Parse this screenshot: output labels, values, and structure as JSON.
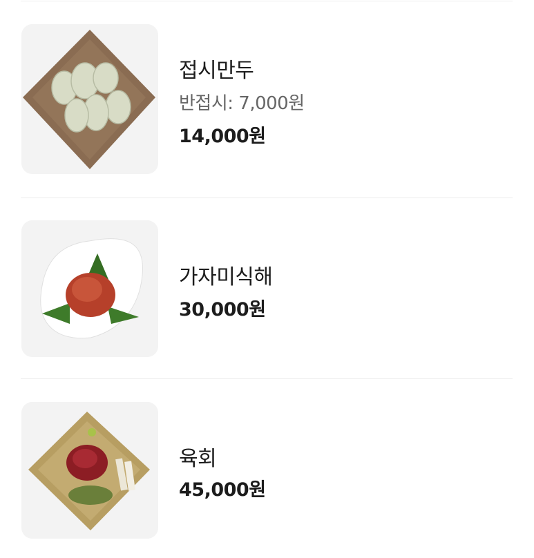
{
  "menu": {
    "items": [
      {
        "name": "접시만두",
        "option": "반접시: 7,000원",
        "price": "14,000원",
        "image": "dumplings-plate-image"
      },
      {
        "name": "가자미식해",
        "price": "30,000원",
        "image": "flatfish-sikhae-image"
      },
      {
        "name": "육회",
        "price": "45,000원",
        "image": "yukhoe-image"
      }
    ]
  }
}
